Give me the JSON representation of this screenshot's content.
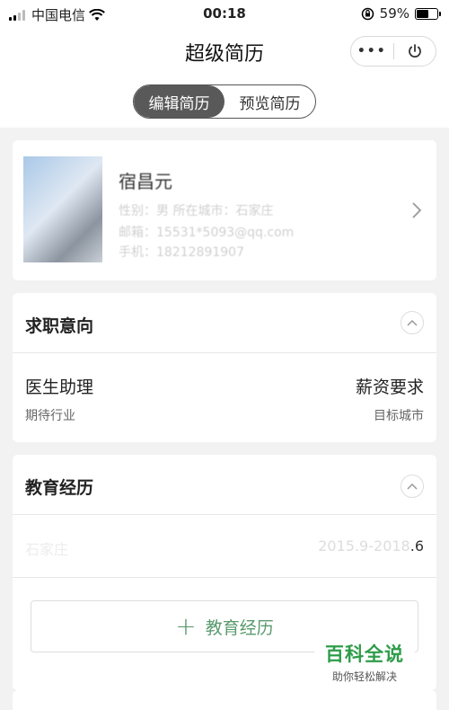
{
  "status_bar": {
    "carrier": "中国电信",
    "time": "00:18",
    "battery_percent": "59%",
    "battery_level": 0.59
  },
  "nav": {
    "title": "超级简历",
    "more_icon": "more-dots-icon",
    "close_icon": "power-icon"
  },
  "tabs": {
    "edit": "编辑简历",
    "preview": "预览简历",
    "active": "edit"
  },
  "profile": {
    "name": "宿昌元",
    "gender_line": "性别：男    所在城市：石家庄",
    "email_line": "邮箱：15531*5093@qq.com",
    "phone_line": "手机：18212891907"
  },
  "job_intent": {
    "title": "求职意向",
    "position": "医生助理",
    "salary": "薪资要求",
    "industry": "期待行业",
    "city": "目标城市"
  },
  "education": {
    "title": "教育经历",
    "school": "石家庄",
    "date_range": "2015.9-2018",
    "date_range_end": ".6",
    "add_button": "教育经历"
  },
  "watermark": {
    "title": "百科全说",
    "subtitle": "助你轻松解决"
  },
  "colors": {
    "accent_green": "#5a9a6e",
    "tab_active": "#595959",
    "watermark_green": "#2e9c4a"
  }
}
